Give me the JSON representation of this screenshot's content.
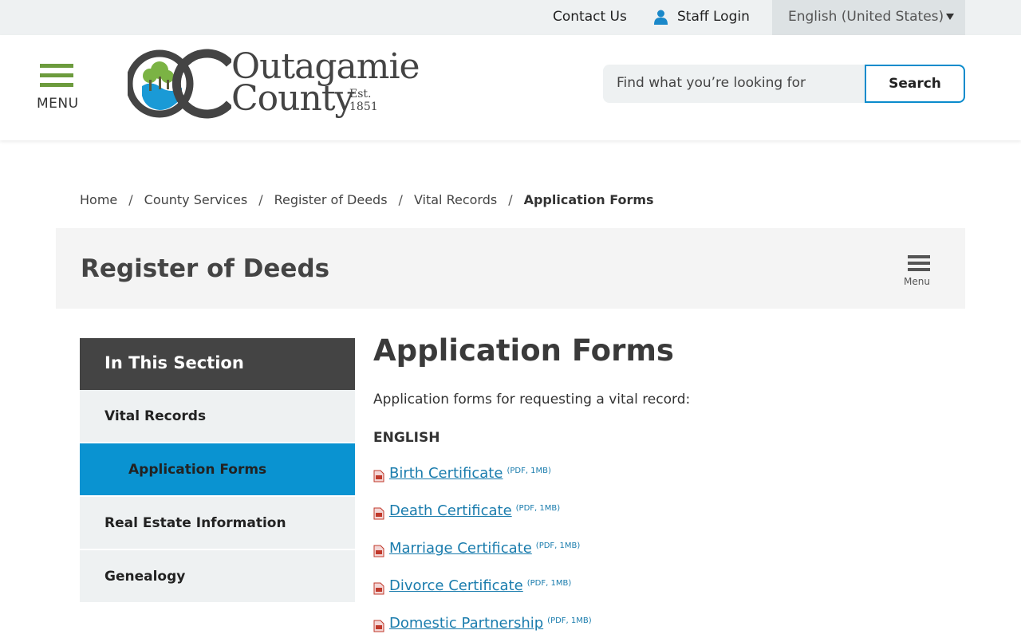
{
  "utility": {
    "contact": "Contact Us",
    "staff_login": "Staff Login",
    "language": "English (United States)"
  },
  "header": {
    "menu_label": "MENU",
    "logo": {
      "line1": "Outagamie",
      "line2": "County",
      "est": "Est. 1851"
    },
    "search": {
      "placeholder": "Find what you’re looking for",
      "button": "Search"
    }
  },
  "breadcrumb": {
    "items": [
      "Home",
      "County Services",
      "Register of Deeds",
      "Vital Records"
    ],
    "separator": "/",
    "current": "Application Forms"
  },
  "department": {
    "title": "Register of Deeds",
    "menu_label": "Menu"
  },
  "sidenav": {
    "heading": "In This Section",
    "items": [
      {
        "label": "Vital Records"
      },
      {
        "label": "Application Forms",
        "active": true
      },
      {
        "label": "Real Estate Information"
      },
      {
        "label": "Genealogy"
      }
    ]
  },
  "main": {
    "title": "Application Forms",
    "intro": "Application forms for requesting a vital record:",
    "subheading": "ENGLISH",
    "documents": [
      {
        "label": "Birth Certificate",
        "meta": "(PDF, 1MB)"
      },
      {
        "label": "Death Certificate",
        "meta": "(PDF, 1MB)"
      },
      {
        "label": "Marriage Certificate",
        "meta": "(PDF, 1MB)"
      },
      {
        "label": "Divorce Certificate",
        "meta": "(PDF, 1MB)"
      },
      {
        "label": "Domestic Partnership",
        "meta": "(PDF, 1MB)"
      }
    ]
  },
  "colors": {
    "accent_green": "#6c9b3d",
    "accent_blue": "#0a93d1",
    "link": "#1a7cad",
    "dark_panel": "#444444"
  }
}
